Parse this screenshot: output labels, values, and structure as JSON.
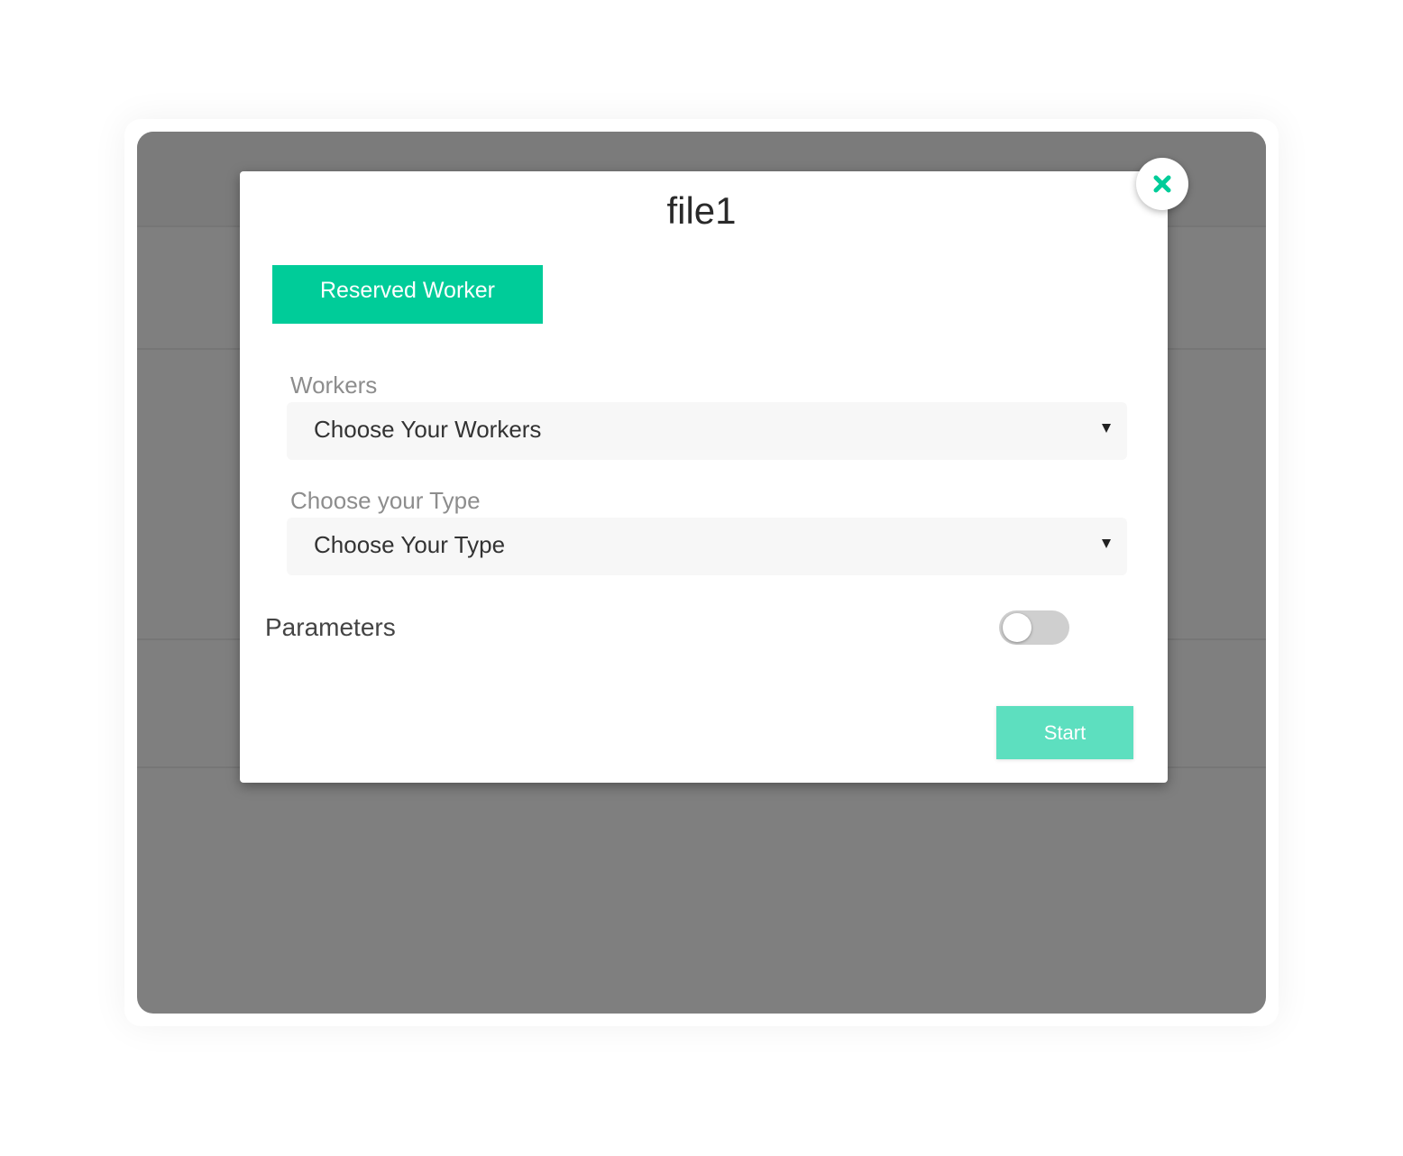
{
  "modal": {
    "title": "file1",
    "close_icon": "close-icon",
    "tabs": [
      {
        "label": "Reserved Worker",
        "active": true
      }
    ],
    "fields": {
      "workers": {
        "label": "Workers",
        "value": "Choose Your Workers"
      },
      "type": {
        "label": "Choose your Type",
        "value": "Choose Your Type"
      }
    },
    "parameters": {
      "label": "Parameters",
      "enabled": false
    },
    "start_label": "Start"
  },
  "colors": {
    "accent": "#00cc99",
    "start_button": "#5ddfbf",
    "backdrop": "#7f7f7f",
    "toggle_off": "#cfcfcf"
  }
}
